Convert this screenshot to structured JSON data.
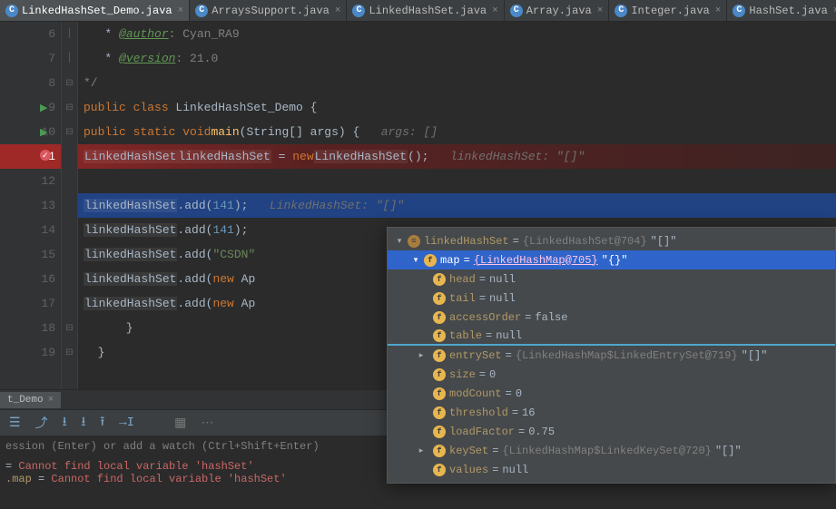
{
  "tabs": [
    {
      "label": "LinkedHashSet_Demo.java",
      "active": true
    },
    {
      "label": "ArraysSupport.java",
      "active": false
    },
    {
      "label": "LinkedHashSet.java",
      "active": false
    },
    {
      "label": "Array.java",
      "active": false
    },
    {
      "label": "Integer.java",
      "active": false
    },
    {
      "label": "HashSet.java",
      "active": false
    }
  ],
  "code": {
    "lines": [
      {
        "n": "6",
        "html": "   * <span class='tag'>@author</span>  <span class='cmt'>: Cyan_RA9</span>"
      },
      {
        "n": "7",
        "html": "   * <span class='tag'>@version</span> <span class='cmt'>: 21.0</span>"
      },
      {
        "n": "8",
        "html": "   <span class='cmt'>*/</span>"
      },
      {
        "n": "9",
        "html": "  <span class='kw'>public class</span> LinkedHashSet_Demo {",
        "run": true
      },
      {
        "n": "10",
        "html": "      <span class='kw'>public static void</span> <span class='mth'>main</span>(String[] args) {   <span class='hint'>args: []</span>",
        "run": true
      },
      {
        "n": "11",
        "html": "          <span class='boxed cls'>LinkedHashSet</span> <span class='boxed'>linkedHashSet</span> = <span class='kw'>new</span> <span class='boxed cls'>LinkedHashSet</span>();   <span class='hint'>linkedHashSet: \"[]\"</span>",
        "bp": true
      },
      {
        "n": "12",
        "html": ""
      },
      {
        "n": "13",
        "html": "          <span class='boxed'>linkedHashSet</span>.add(<span class='num'>141</span>);   <span class='hint'>LinkedHashSet: \"[]\"</span>",
        "current": true
      },
      {
        "n": "14",
        "html": "          <span class='boxed'>linkedHashSet</span>.add(<span class='num'>141</span>);"
      },
      {
        "n": "15",
        "html": "          <span class='boxed'>linkedHashSet</span>.add(<span class='str'>\"CSDN\"</span>"
      },
      {
        "n": "16",
        "html": "          <span class='boxed'>linkedHashSet</span>.add(<span class='kw'>new</span> Ap"
      },
      {
        "n": "17",
        "html": "          <span class='boxed'>linkedHashSet</span>.add(<span class='kw'>new</span> Ap"
      },
      {
        "n": "18",
        "html": "      }"
      },
      {
        "n": "19",
        "html": "  }"
      }
    ]
  },
  "context_tab": "t_Demo",
  "watch_placeholder": "ession (Enter) or add a watch (Ctrl+Shift+Enter)",
  "console_errors": [
    {
      "lhs": "",
      "msg": "Cannot find local variable 'hashSet'"
    },
    {
      "lhs": ".map",
      "msg": "Cannot find local variable 'hashSet'"
    }
  ],
  "vars": {
    "root": {
      "name": "linkedHashSet",
      "type": "{LinkedHashSet@704}",
      "val": "\"[]\""
    },
    "map": {
      "name": "map",
      "type": "{LinkedHashMap@705}",
      "val": "\"{}\""
    },
    "fields": [
      {
        "name": "head",
        "val": "null"
      },
      {
        "name": "tail",
        "val": "null"
      },
      {
        "name": "accessOrder",
        "val": "false"
      },
      {
        "name": "table",
        "val": "null",
        "sep": true
      },
      {
        "name": "entrySet",
        "type": "{LinkedHashMap$LinkedEntrySet@719}",
        "val": "\"[]\"",
        "exp": true
      },
      {
        "name": "size",
        "val": "0"
      },
      {
        "name": "modCount",
        "val": "0"
      },
      {
        "name": "threshold",
        "val": "16"
      },
      {
        "name": "loadFactor",
        "val": "0.75"
      },
      {
        "name": "keySet",
        "type": "{LinkedHashMap$LinkedKeySet@720}",
        "val": "\"[]\"",
        "exp": true
      },
      {
        "name": "values",
        "val": "null"
      }
    ]
  }
}
